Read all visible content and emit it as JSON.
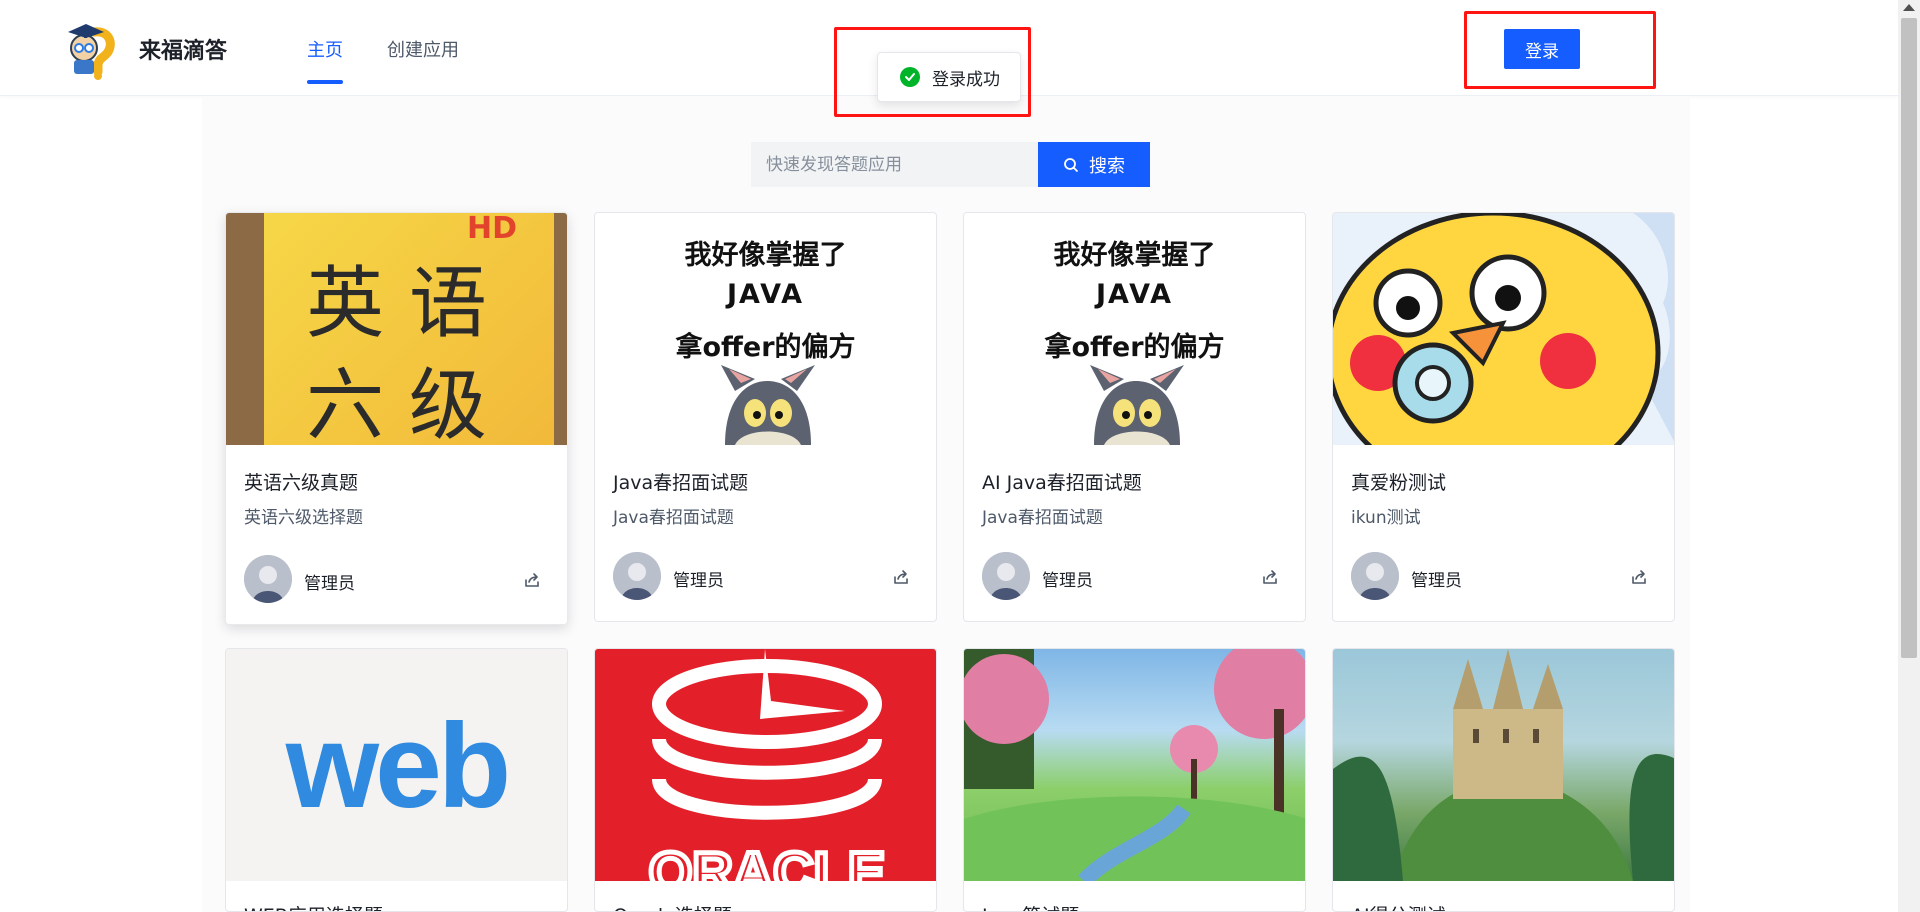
{
  "header": {
    "brand": "来福滴答",
    "nav": [
      {
        "label": "主页",
        "active": true
      },
      {
        "label": "创建应用",
        "active": false
      }
    ],
    "login_label": "登录"
  },
  "toast": {
    "message": "登录成功"
  },
  "search": {
    "placeholder": "快速发现答题应用",
    "button_label": "搜索"
  },
  "cards": [
    {
      "title": "英语六级真题",
      "desc": "英语六级选择题",
      "author": "管理员",
      "thumb_text": [
        "英 语",
        "六 级"
      ],
      "thumb_badge": "HD"
    },
    {
      "title": "Java春招面试题",
      "desc": "Java春招面试题",
      "author": "管理员",
      "thumb_text": [
        "我好像掌握了",
        "JAVA",
        "拿offer的偏方"
      ]
    },
    {
      "title": "AI Java春招面试题",
      "desc": "Java春招面试题",
      "author": "管理员",
      "thumb_text": [
        "我好像掌握了",
        "JAVA",
        "拿offer的偏方"
      ]
    },
    {
      "title": "真爱粉测试",
      "desc": "ikun测试",
      "author": "管理员"
    },
    {
      "title": "WEB应用选择题",
      "desc": "",
      "author": "",
      "thumb_text": [
        "web"
      ]
    },
    {
      "title": "Oracle选择题",
      "desc": "",
      "author": "",
      "thumb_text": [
        "ORACLE"
      ]
    },
    {
      "title": "Java简试题",
      "desc": "",
      "author": ""
    },
    {
      "title": "AI得分测试",
      "desc": "",
      "author": ""
    }
  ],
  "colors": {
    "primary": "#165dff",
    "success": "#00b42a",
    "annotation": "#ff1414"
  }
}
